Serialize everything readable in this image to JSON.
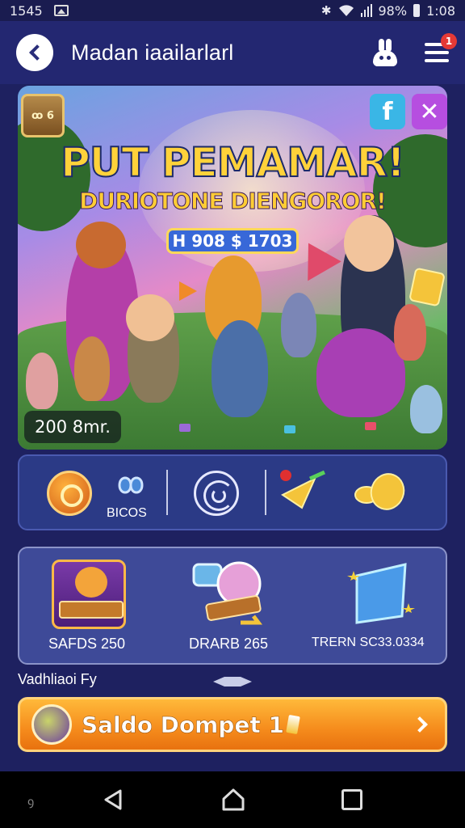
{
  "status_bar": {
    "time": "1545",
    "battery": "98%",
    "clock": "1:08"
  },
  "header": {
    "title": "Madan iaailarlarl",
    "notification_count": "1"
  },
  "banner": {
    "chest_label": "ꝏ 6",
    "title": "PUT PEMAMAR!",
    "subtitle": "DURIOTONE DIENGOROR!",
    "pill": "H 908 $ 1703",
    "amount": "200 8mr."
  },
  "features": {
    "items": [
      {
        "label": "",
        "icon": "coin-icon"
      },
      {
        "label": "BICOS",
        "icon": "ribbon-icon"
      },
      {
        "label": "",
        "icon": "spiral-icon"
      },
      {
        "label": "",
        "icon": "arrow-star-icon"
      },
      {
        "label": "",
        "icon": "gold-coins-icon"
      }
    ]
  },
  "rewards": {
    "items": [
      {
        "label": "SAFDS 250",
        "icon": "frame-badge-icon"
      },
      {
        "label": "DRARB 265",
        "icon": "toy-cart-icon"
      },
      {
        "label": "TRERN SC33.0334",
        "icon": "crystal-icon"
      }
    ]
  },
  "section": {
    "label": "Vadhliaoi Fy"
  },
  "cta": {
    "label": "Saldo Dompet 1"
  },
  "colors": {
    "background": "#1e2160",
    "cta": "#f58b1c",
    "accent": "#ffd23a"
  }
}
